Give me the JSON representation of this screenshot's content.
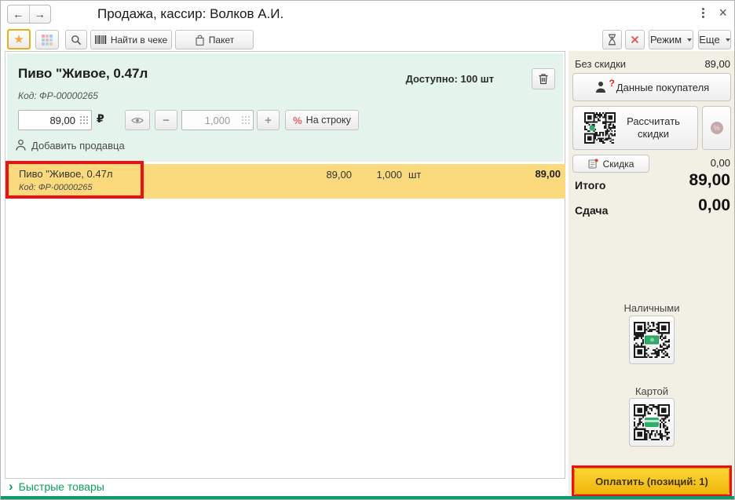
{
  "colors": {
    "panel_green": "#e4f3eb",
    "row_yellow": "#fbda7d",
    "panel_beige": "#f2efe5",
    "annotation_red": "#ee1111",
    "accent_green": "#0aa155",
    "pay_yellow": "#f5c81d"
  },
  "window": {
    "title": "Продажа, кассир: Волков А.И.",
    "close_icon": "×"
  },
  "titlebar": {
    "back": "←",
    "forward": "→"
  },
  "toolbar": {
    "star_icon": "★",
    "find_in_receipt": "Найти в чеке",
    "package": "Пакет",
    "mode": "Режим",
    "more": "Еще"
  },
  "product_panel": {
    "name": "Пиво \"Живое, 0.47л",
    "code": "Код: ФР-00000265",
    "available": "Доступно: 100 шт",
    "price": "89,00",
    "currency": "₽",
    "minus": "−",
    "plus": "+",
    "quantity": "1,000",
    "percent": "%",
    "per_line": "На строку",
    "add_seller": "Добавить продавца"
  },
  "receipt_row": {
    "name": "Пиво \"Живое, 0.47л",
    "code": "Код: ФР-00000265",
    "price": "89,00",
    "qty": "1,000",
    "unit": "шт",
    "total": "89,00"
  },
  "quick_goods": {
    "chevron": "›",
    "label": "Быстрые товары"
  },
  "right_panel": {
    "no_discount_label": "Без скидки",
    "no_discount_value": "89,00",
    "customer_button": "Данные покупателя",
    "customer_hint": "?",
    "calc_discounts": "Рассчитать скидки",
    "percent_badge": "%",
    "discount_button": "Скидка",
    "discount_value": "0,00",
    "total_label": "Итого",
    "total_value": "89,00",
    "change_label": "Сдача",
    "change_value": "0,00",
    "cash_label": "Наличными",
    "card_label": "Картой",
    "pay_button": "Оплатить (позиций: 1)"
  }
}
